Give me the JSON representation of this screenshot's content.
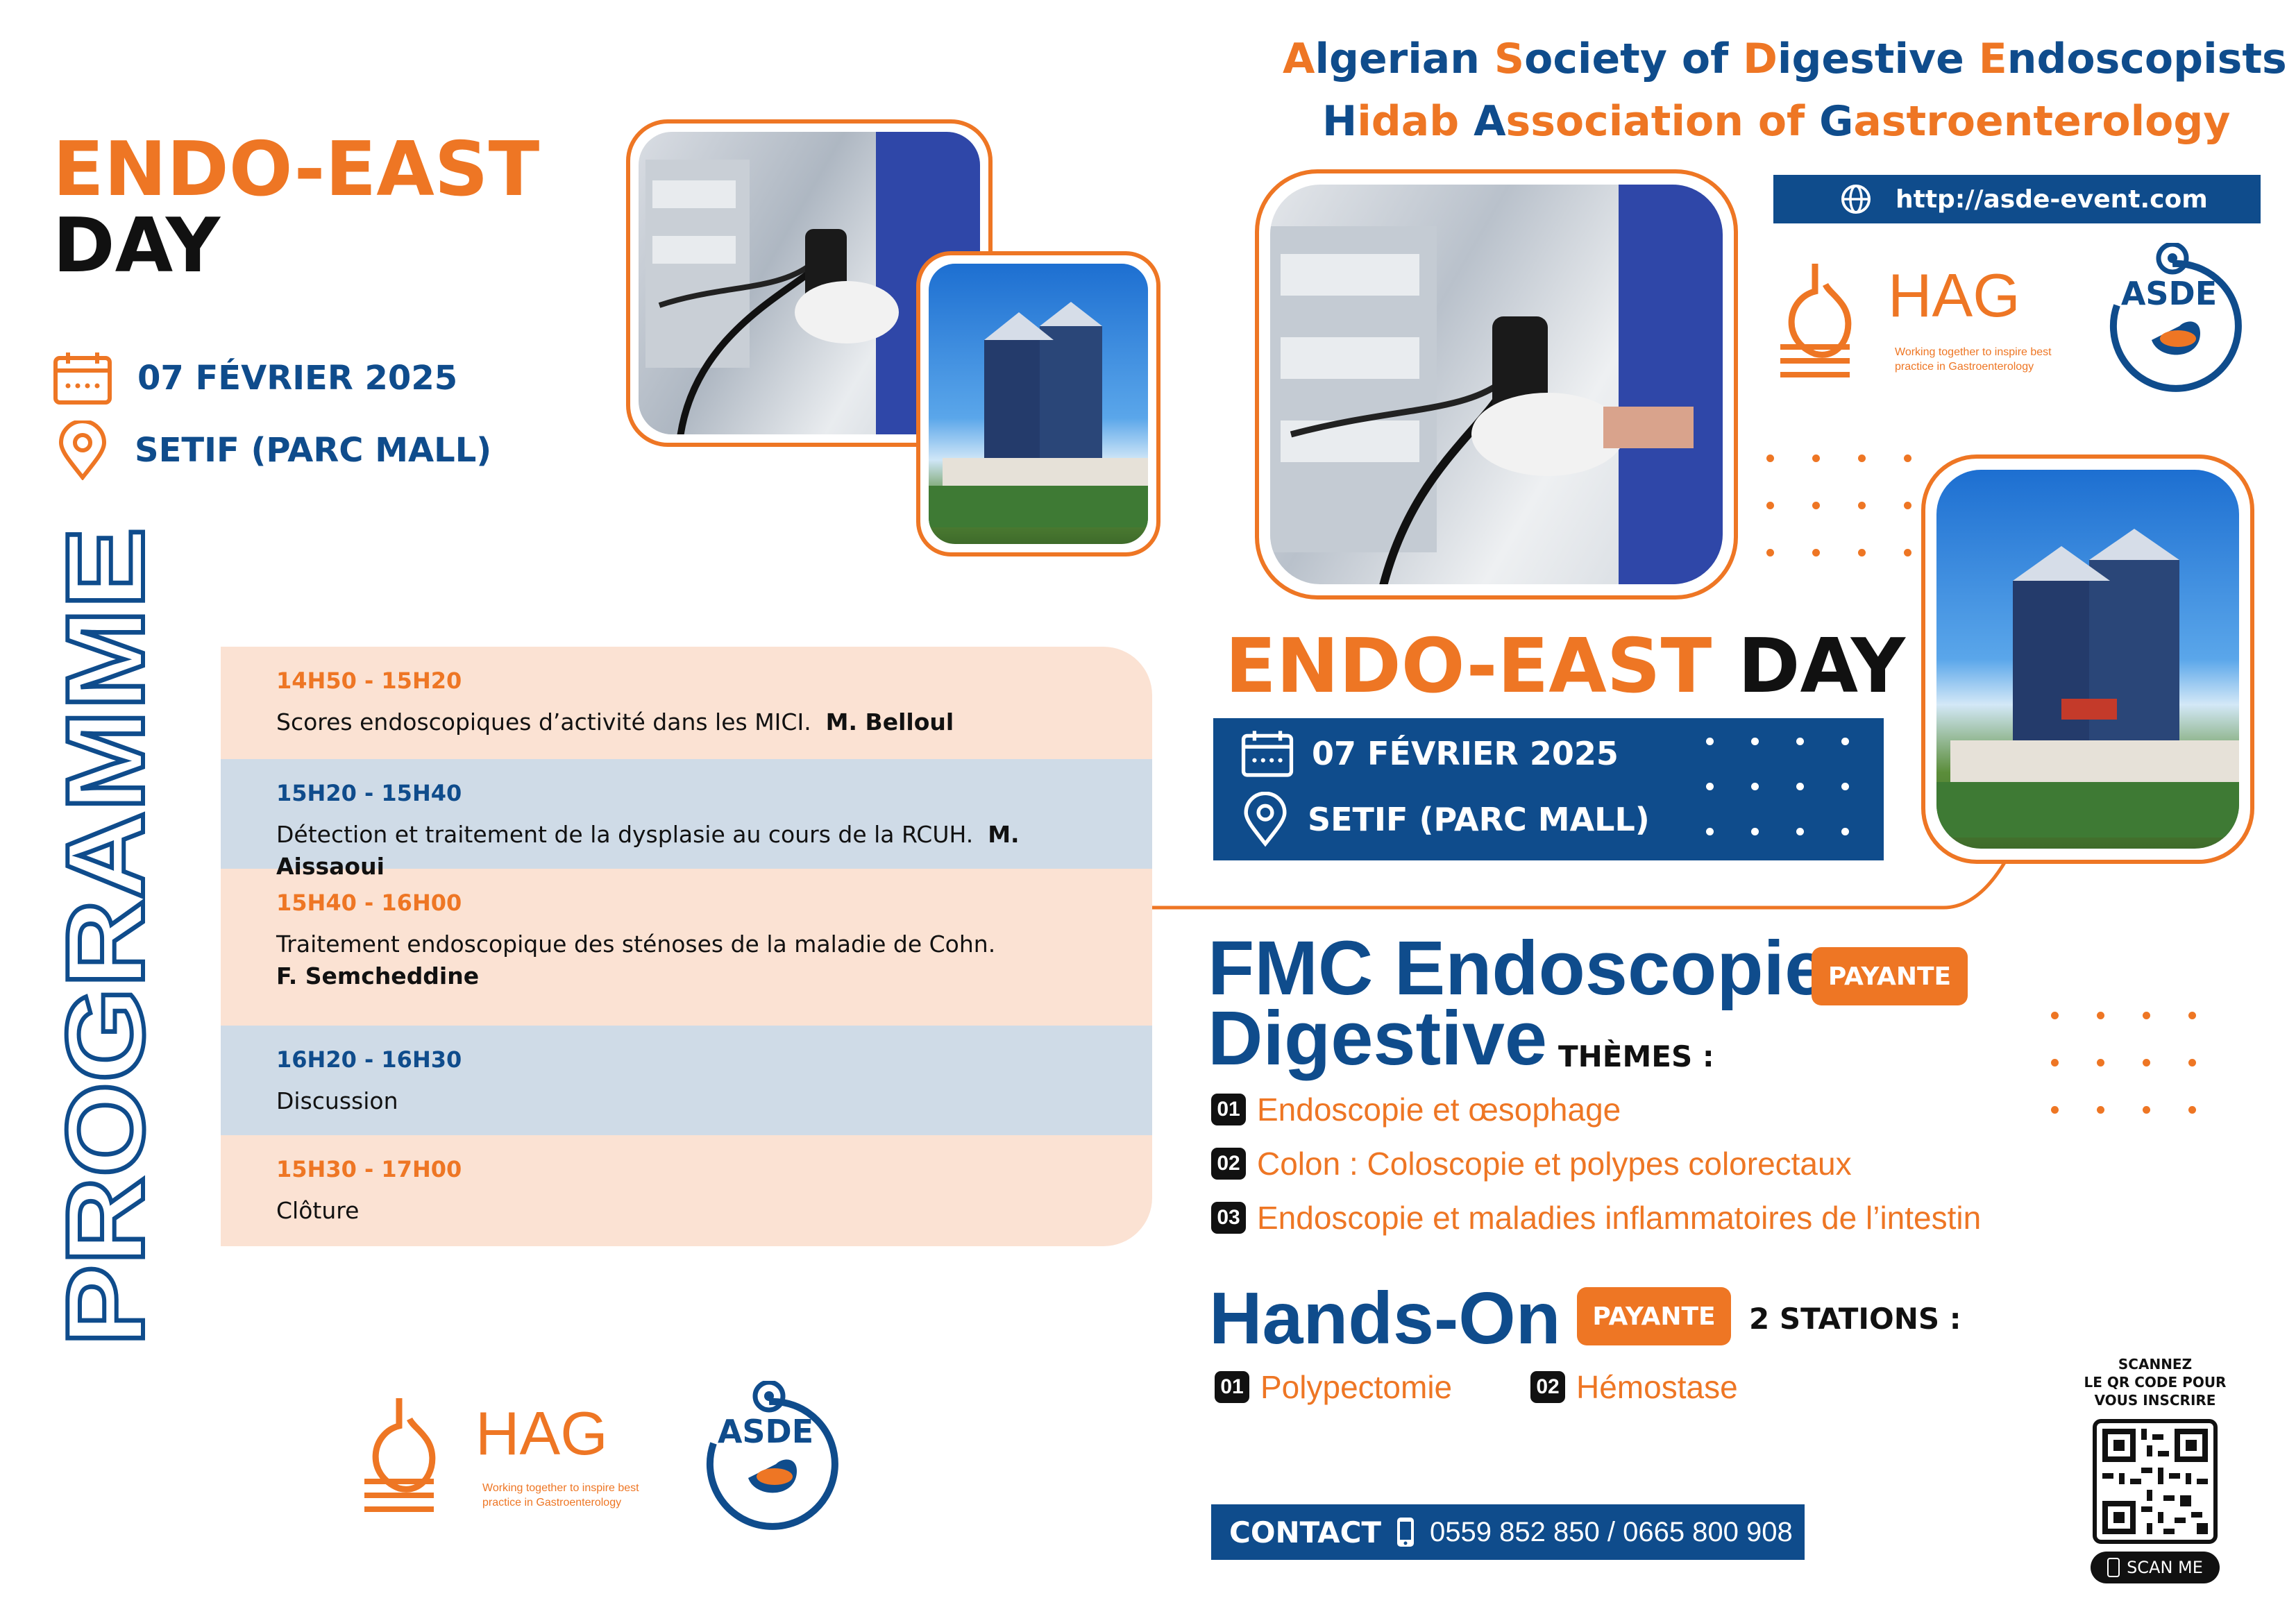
{
  "left_header": {
    "title_line1": "ENDO-EAST",
    "title_line2": "DAY",
    "date": "07 FÉVRIER 2025",
    "location": "SETIF (PARC MALL)"
  },
  "programme_label": "PROGRAMME",
  "schedule": [
    {
      "time": "14H50 - 15H20",
      "desc": "Scores endoscopiques d’activité dans les MICI.",
      "speaker": "M. Belloul",
      "style": "peach"
    },
    {
      "time": "15H20 - 15H40",
      "desc": "Détection et traitement de la dysplasie au cours de la RCUH.",
      "speaker": "M. Aissaoui",
      "style": "grey"
    },
    {
      "time": "15H40 - 16H00",
      "desc": "Traitement endoscopique des sténoses de la maladie de Cohn.",
      "speaker": "F. Semcheddine",
      "style": "peach"
    },
    {
      "time": "16H20 - 16H30",
      "desc": "Discussion",
      "speaker": "",
      "style": "grey"
    },
    {
      "time": "15H30 - 17H00",
      "desc": "Clôture",
      "speaker": "",
      "style": "peach"
    }
  ],
  "org": {
    "line1": [
      [
        "A",
        "o"
      ],
      [
        "lgerian ",
        "b"
      ],
      [
        "S",
        "o"
      ],
      [
        "ociety of ",
        "b"
      ],
      [
        "D",
        "o"
      ],
      [
        "igestive ",
        "b"
      ],
      [
        "E",
        "o"
      ],
      [
        "ndoscopists",
        "b"
      ]
    ],
    "line2": [
      [
        "H",
        "b"
      ],
      [
        "idab ",
        "o"
      ],
      [
        "A",
        "b"
      ],
      [
        "ssociation of ",
        "o"
      ],
      [
        "G",
        "b"
      ],
      [
        "astroenterology",
        "o"
      ]
    ],
    "url": "http://asde-event.com"
  },
  "hag_logo": {
    "name": "HAG",
    "tagline_1": "Working together to inspire best",
    "tagline_2": "practice in Gastroenterology"
  },
  "asde_logo": {
    "name": "ASDE"
  },
  "center": {
    "title_orange": "ENDO-EAST",
    "title_black": "DAY",
    "date": "07 FÉVRIER 2025",
    "location": "SETIF (PARC MALL)"
  },
  "fmc": {
    "title_line1": "FMC Endoscopie",
    "title_line2": "Digestive",
    "badge": "PAYANTE",
    "themes_label": "THÈMES :",
    "themes": [
      {
        "num": "01",
        "label": "Endoscopie et œsophage"
      },
      {
        "num": "02",
        "label": "Colon : Coloscopie et polypes colorectaux"
      },
      {
        "num": "03",
        "label": "Endoscopie et maladies inflammatoires de l’intestin"
      }
    ]
  },
  "hands_on": {
    "title": "Hands-On",
    "badge": "PAYANTE",
    "stations_label": "2 STATIONS :",
    "stations": [
      {
        "num": "01",
        "label": "Polypectomie"
      },
      {
        "num": "02",
        "label": "Hémostase"
      }
    ]
  },
  "contact": {
    "label": "CONTACT",
    "phones": "0559 852 850 / 0665 800 908"
  },
  "qr": {
    "caption_1": "SCANNEZ",
    "caption_2": "LE QR CODE POUR",
    "caption_3": "VOUS INSCRIRE",
    "scan_label": "SCAN ME"
  },
  "colors": {
    "orange": "#ee7624",
    "blue": "#0f4c8c",
    "peach": "#fbe2d3",
    "grey": "#cfdbe7"
  },
  "icons": [
    "calendar-icon",
    "location-pin-icon",
    "globe-icon",
    "phone-icon",
    "stomach-icon",
    "endoscope-icon"
  ]
}
